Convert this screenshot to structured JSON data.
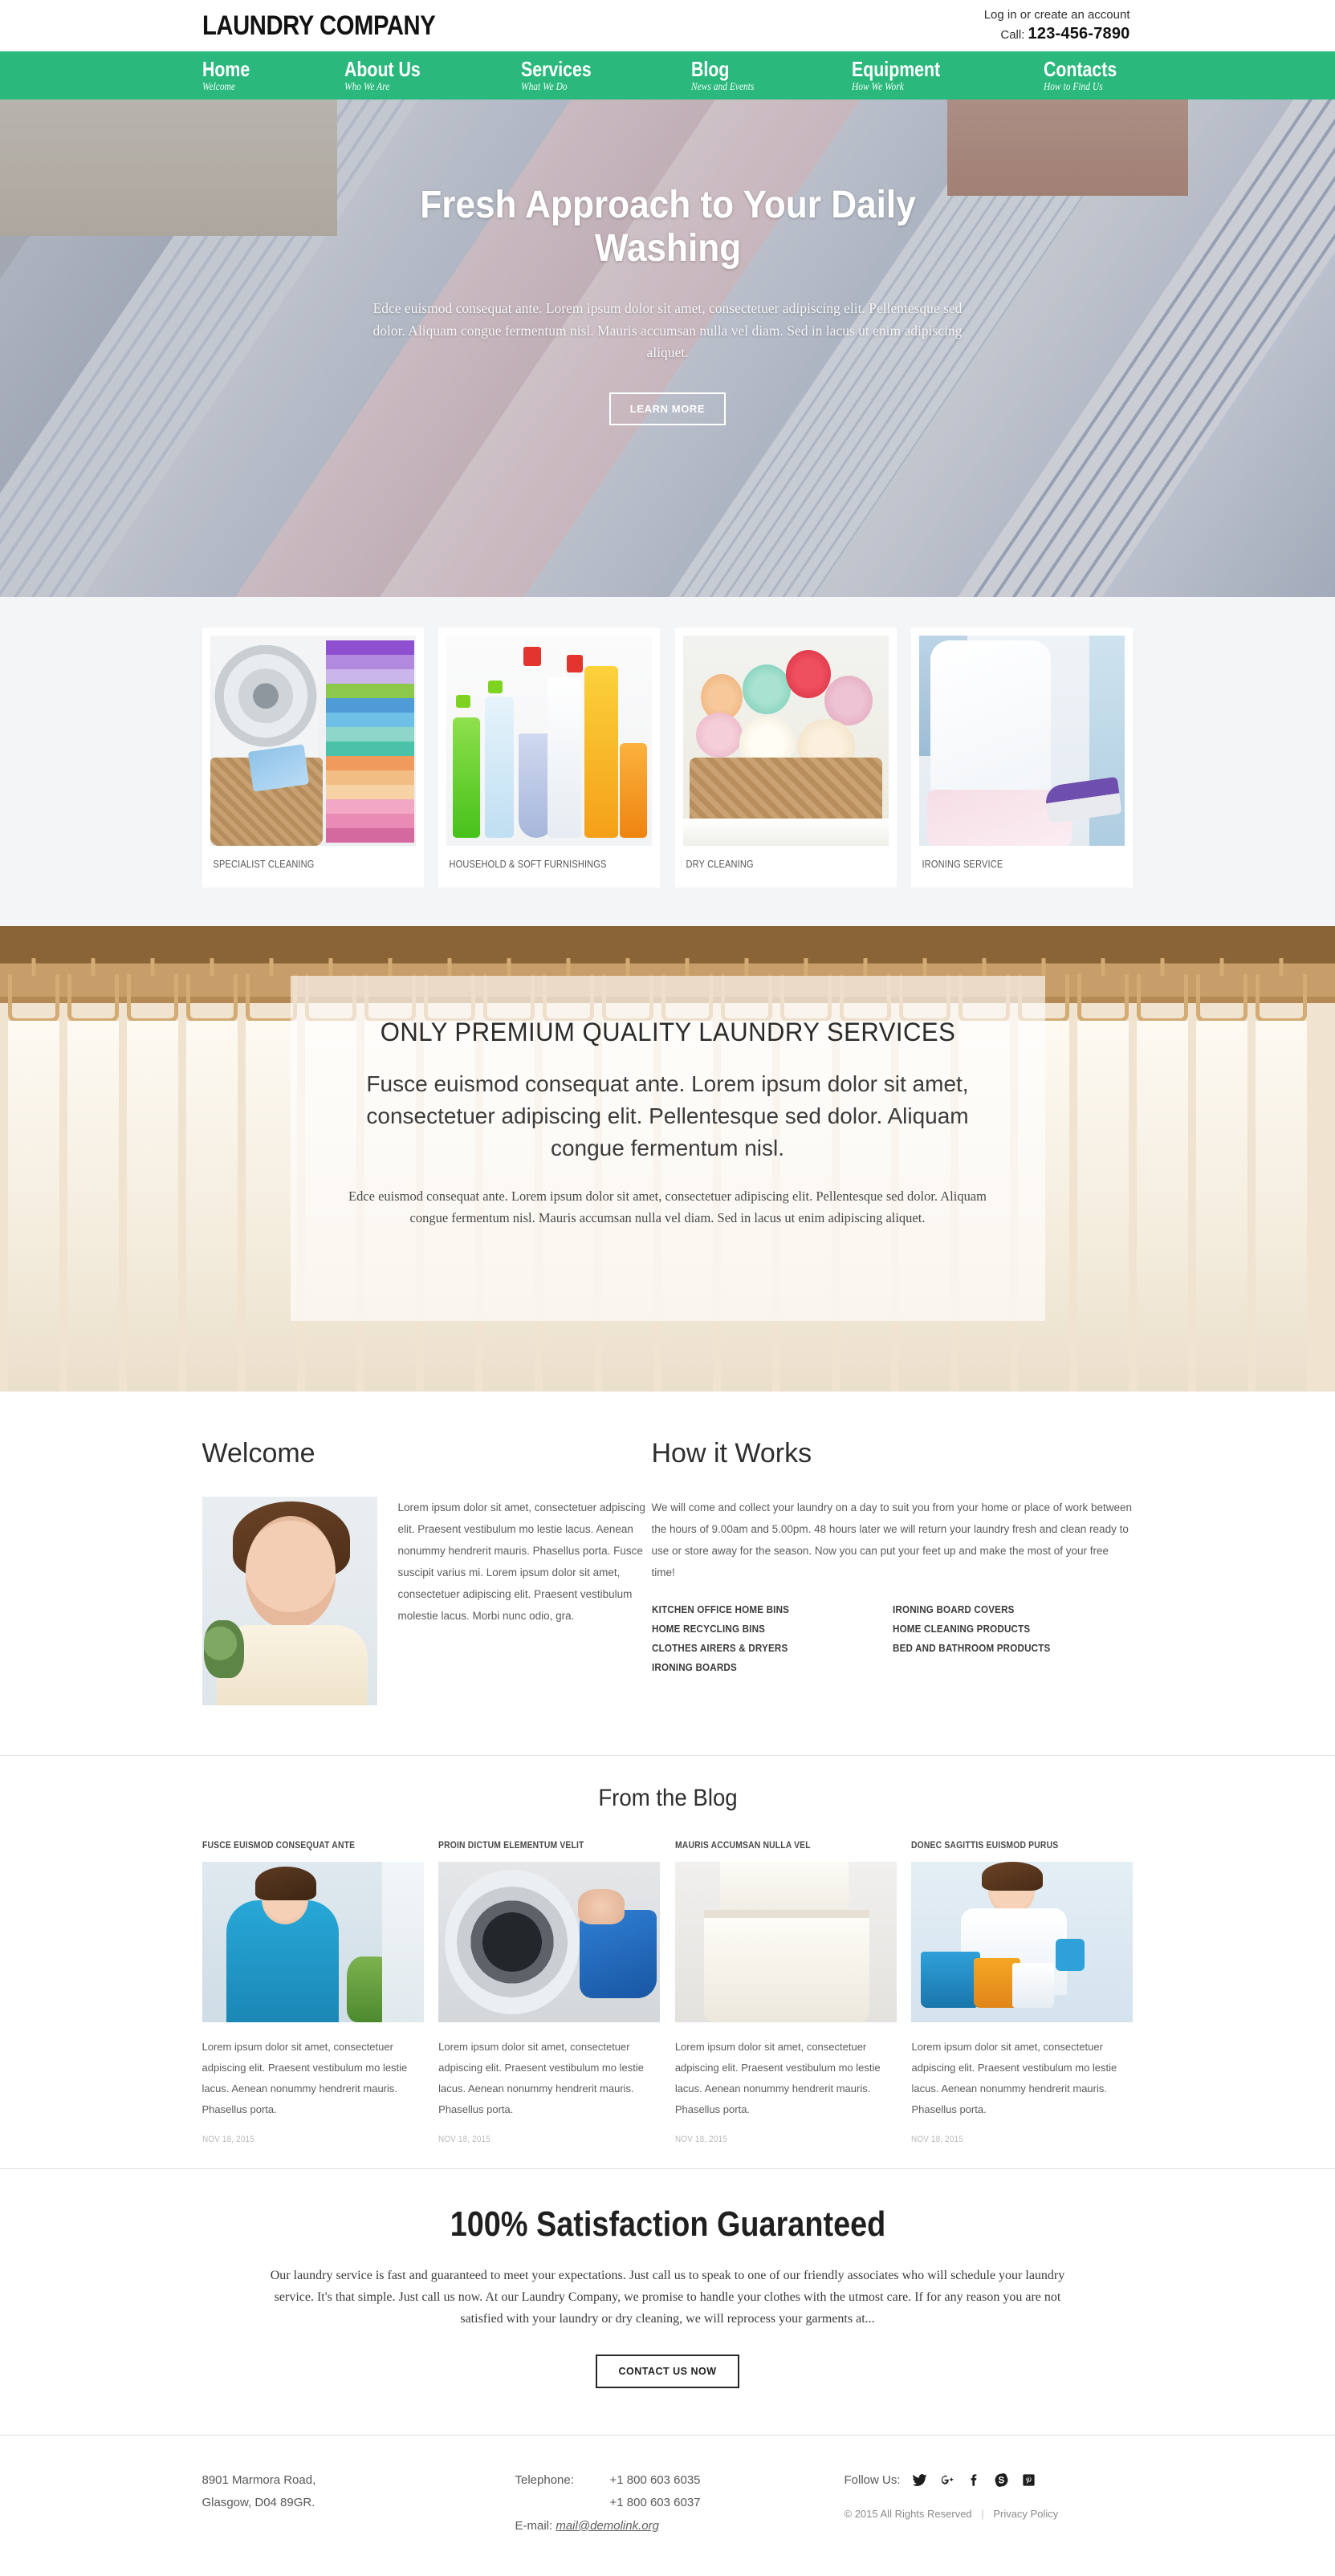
{
  "header": {
    "brand": "LAUNDRY COMPANY",
    "login_text": "Log in or create an account",
    "call_label": "Call:",
    "phone": "123-456-7890"
  },
  "nav": {
    "items": [
      {
        "title": "Home",
        "sub": "Welcome"
      },
      {
        "title": "About Us",
        "sub": "Who We Are"
      },
      {
        "title": "Services",
        "sub": "What We Do"
      },
      {
        "title": "Blog",
        "sub": "News and Events"
      },
      {
        "title": "Equipment",
        "sub": "How We Work"
      },
      {
        "title": "Contacts",
        "sub": "How to Find Us"
      }
    ]
  },
  "hero": {
    "title": "Fresh Approach to Your Daily Washing",
    "subtitle": "Edce euismod consequat ante. Lorem ipsum dolor sit amet, consectetuer adipiscing elit. Pellentesque sed dolor. Aliquam congue fermentum nisl. Mauris accumsan nulla vel diam. Sed in lacus ut enim adipiscing aliquet.",
    "button": "LEARN MORE"
  },
  "services": {
    "cards": [
      {
        "label": "SPECIALIST CLEANING"
      },
      {
        "label": "HOUSEHOLD & SOFT FURNISHINGS"
      },
      {
        "label": "DRY CLEANING"
      },
      {
        "label": "IRONING SERVICE"
      }
    ]
  },
  "premium": {
    "heading": "ONLY PREMIUM QUALITY LAUNDRY SERVICES",
    "lead": "Fusce euismod consequat ante. Lorem ipsum dolor sit amet, consectetuer adipiscing elit. Pellentesque sed dolor. Aliquam congue fermentum nisl.",
    "small": "Edce euismod consequat ante. Lorem ipsum dolor sit amet, consectetuer adipiscing elit. Pellentesque sed dolor. Aliquam congue fermentum nisl. Mauris accumsan nulla vel diam. Sed in lacus ut enim adipiscing aliquet."
  },
  "welcome": {
    "heading": "Welcome",
    "text": "Lorem ipsum dolor sit amet, consectetuer adpiscing elit. Praesent vestibulum mo lestie lacus. Aenean nonummy hendrerit mauris. Phasellus porta. Fusce suscipit varius mi. Lorem ipsum dolor sit amet, consectetuer adipiscing elit. Praesent vestibulum molestie lacus. Morbi nunc odio, gra."
  },
  "how_it_works": {
    "heading": "How it Works",
    "text": "We will come and collect your laundry on a day to suit you from your home or place of work between the hours of 9.00am and 5.00pm. 48 hours later we will return your laundry fresh and clean ready to use or store away for the season. Now you can put your feet up and make the most of your free time!",
    "list_left": [
      "KITCHEN OFFICE HOME BINS",
      "HOME RECYCLING BINS",
      "CLOTHES AIRERS & DRYERS",
      "IRONING BOARDS"
    ],
    "list_right": [
      "IRONING BOARD COVERS",
      "HOME CLEANING PRODUCTS",
      "BED AND BATHROOM PRODUCTS"
    ]
  },
  "blog": {
    "heading": "From the Blog",
    "posts": [
      {
        "title": "FUSCE EUISMOD CONSEQUAT ANTE",
        "text": "Lorem ipsum dolor sit amet, consectetuer adpiscing elit. Praesent vestibulum mo lestie lacus. Aenean nonummy hendrerit mauris. Phasellus porta.",
        "date": "NOV 18, 2015"
      },
      {
        "title": "PROIN DICTUM ELEMENTUM VELIT",
        "text": "Lorem ipsum dolor sit amet, consectetuer adpiscing elit. Praesent vestibulum mo lestie lacus. Aenean nonummy hendrerit mauris. Phasellus porta.",
        "date": "NOV 18, 2015"
      },
      {
        "title": "MAURIS ACCUMSAN NULLA VEL",
        "text": "Lorem ipsum dolor sit amet, consectetuer adpiscing elit. Praesent vestibulum mo lestie lacus. Aenean nonummy hendrerit mauris. Phasellus porta.",
        "date": "NOV 18, 2015"
      },
      {
        "title": "DONEC SAGITTIS EUISMOD PURUS",
        "text": "Lorem ipsum dolor sit amet, consectetuer adpiscing elit. Praesent vestibulum mo lestie lacus. Aenean nonummy hendrerit mauris. Phasellus porta.",
        "date": "NOV 18, 2015"
      }
    ]
  },
  "guarantee": {
    "heading": "100% Satisfaction Guaranteed",
    "text": "Our laundry service is fast and guaranteed to meet your expectations. Just call us to speak to one of our friendly associates who will schedule your laundry service. It's that simple. Just call us now. At our Laundry Company, we promise to handle your clothes with the utmost care. If for any reason you are not satisfied with your laundry or dry cleaning, we will reprocess your garments at...",
    "button": "CONTACT US NOW"
  },
  "footer": {
    "address_line1": "8901 Marmora Road,",
    "address_line2": "Glasgow, D04 89GR.",
    "telephone_label": "Telephone:",
    "telephone_1": "+1 800 603 6035",
    "telephone_2": "+1 800 603 6037",
    "email_label": "E-mail:",
    "email": "mail@demolink.org",
    "follow_label": "Follow Us:",
    "social": [
      "twitter-icon",
      "google-plus-icon",
      "facebook-icon",
      "skype-icon",
      "pinterest-icon"
    ],
    "copyright": "© 2015 All Rights Reserved",
    "privacy": "Privacy Policy"
  },
  "colors": {
    "accent": "#2ab87c",
    "text": "#3a3a3a",
    "muted": "#8b8b8b",
    "services_bg": "#f3f5f7"
  }
}
